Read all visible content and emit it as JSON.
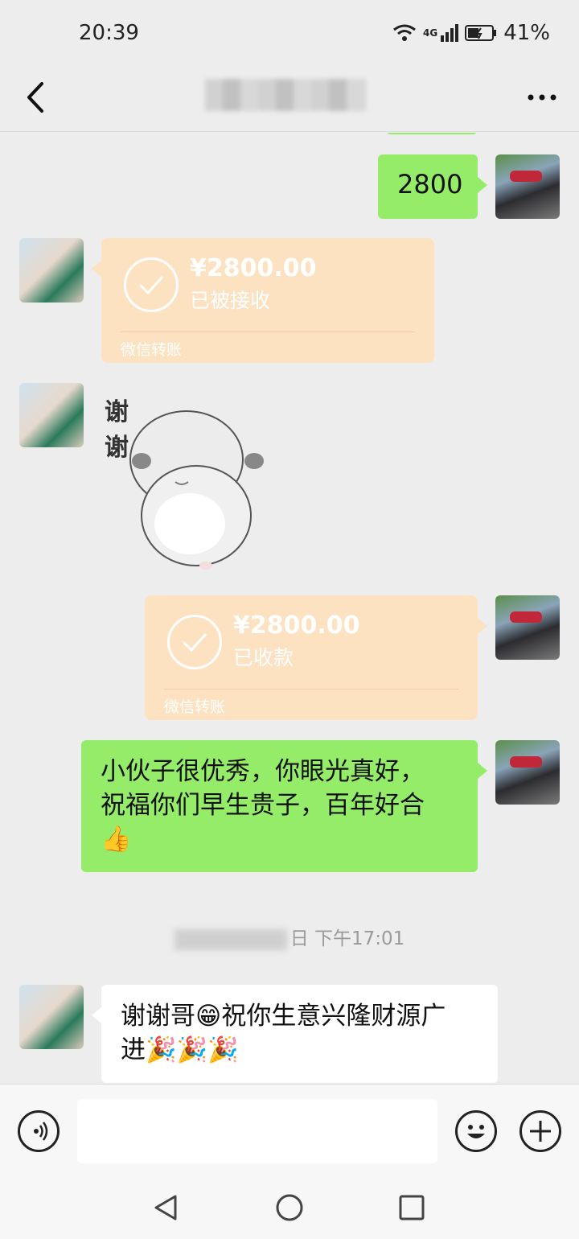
{
  "status_bar": {
    "time": "20:39",
    "network": "4G",
    "battery": "41%"
  },
  "nav": {
    "back_icon": "chevron-left-icon",
    "more_icon": "more-dots-icon"
  },
  "messages": {
    "m1": {
      "text": "2800"
    },
    "m2": {
      "amount": "¥2800.00",
      "status": "已被接收",
      "footer": "微信转账"
    },
    "m3": {
      "sticker_text": "谢谢"
    },
    "m4": {
      "amount": "¥2800.00",
      "status": "已收款",
      "footer": "微信转账"
    },
    "m5": {
      "line1": "小伙子很优秀，你眼光真好，",
      "line2": "祝福你们早生贵子，百年好合",
      "emoji": "👍"
    },
    "timestamp": {
      "suffix": "日 下午17:01"
    },
    "m6": {
      "line1": "谢谢哥😁祝你生意兴隆财源广",
      "line2": "进🎉🎉🎉"
    }
  },
  "input": {
    "placeholder": ""
  },
  "colors": {
    "self_bubble": "#95ec69",
    "transfer_card": "#fde2c2",
    "background": "#ededed"
  }
}
